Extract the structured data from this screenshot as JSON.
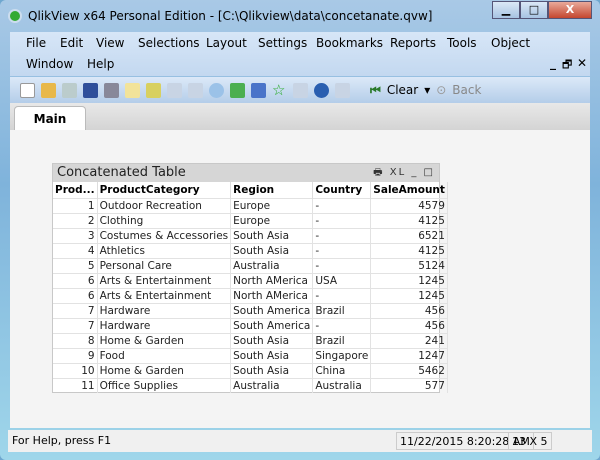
{
  "window": {
    "title": "QlikView x64 Personal Edition - [C:\\Qlikview\\data\\concetanate.qvw]",
    "minimize": "▁",
    "maximize": "□",
    "close": "X"
  },
  "menu": [
    "File",
    "Edit",
    "View",
    "Selections",
    "Layout",
    "Settings",
    "Bookmarks",
    "Reports",
    "Tools",
    "Object",
    "Window",
    "Help"
  ],
  "mdi_controls": {
    "minimize": "_",
    "restore": "🗗",
    "close": "✕"
  },
  "toolbar": {
    "clear_label": "Clear",
    "back_label": "Back"
  },
  "tabs": [
    {
      "label": "Main",
      "active": true
    }
  ],
  "table": {
    "title": "Concatenated Table",
    "caption_icons": "🖶 XL _ □",
    "columns": [
      "Prod...",
      "ProductCategory",
      "Region",
      "Country",
      "SaleAmount"
    ],
    "rows": [
      [
        "1",
        "Outdoor Recreation",
        "Europe",
        "-",
        "4579"
      ],
      [
        "2",
        "Clothing",
        "Europe",
        "-",
        "4125"
      ],
      [
        "3",
        "Costumes & Accessories",
        "South Asia",
        "-",
        "6521"
      ],
      [
        "4",
        "Athletics",
        "South Asia",
        "-",
        "4125"
      ],
      [
        "5",
        "Personal Care",
        "Australia",
        "-",
        "5124"
      ],
      [
        "6",
        "Arts & Entertainment",
        "North AMerica",
        "USA",
        "1245"
      ],
      [
        "6",
        "Arts & Entertainment",
        "North AMerica",
        "-",
        "1245"
      ],
      [
        "7",
        "Hardware",
        "South America",
        "Brazil",
        "456"
      ],
      [
        "7",
        "Hardware",
        "South America",
        "-",
        "456"
      ],
      [
        "8",
        "Home & Garden",
        "South Asia",
        "Brazil",
        "241"
      ],
      [
        "9",
        "Food",
        "South Asia",
        "Singapore",
        "1247"
      ],
      [
        "10",
        "Home & Garden",
        "South Asia",
        "China",
        "5462"
      ],
      [
        "11",
        "Office Supplies",
        "Australia",
        "Australia",
        "577"
      ]
    ]
  },
  "status": {
    "help": "For Help, press F1",
    "datetime": "11/22/2015 8:20:28 AM",
    "dims": "13 X 5"
  }
}
